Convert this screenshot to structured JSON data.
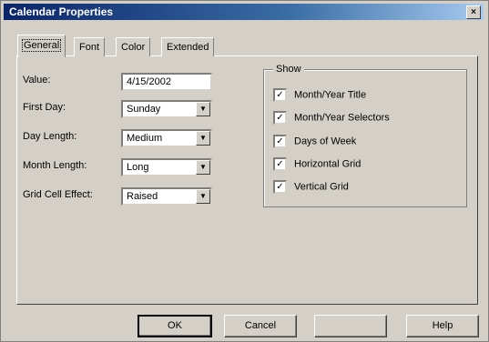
{
  "window": {
    "title": "Calendar Properties",
    "close_glyph": "×"
  },
  "tabs": [
    {
      "label": "General",
      "active": true
    },
    {
      "label": "Font",
      "active": false
    },
    {
      "label": "Color",
      "active": false
    },
    {
      "label": "Extended",
      "active": false
    }
  ],
  "general": {
    "value_label": "Value:",
    "value": "4/15/2002",
    "first_day_label": "First Day:",
    "first_day": "Sunday",
    "day_length_label": "Day Length:",
    "day_length": "Medium",
    "month_length_label": "Month Length:",
    "month_length": "Long",
    "grid_cell_effect_label": "Grid Cell Effect:",
    "grid_cell_effect": "Raised",
    "dropdown_arrow": "▼"
  },
  "show": {
    "title": "Show",
    "items": [
      {
        "label": "Month/Year Title",
        "checked": true
      },
      {
        "label": "Month/Year Selectors",
        "checked": true
      },
      {
        "label": "Days of Week",
        "checked": true
      },
      {
        "label": "Horizontal Grid",
        "checked": true
      },
      {
        "label": "Vertical Grid",
        "checked": true
      }
    ],
    "check_glyph": "✓"
  },
  "buttons": {
    "ok": "OK",
    "cancel": "Cancel",
    "apply": "",
    "help": "Help"
  }
}
